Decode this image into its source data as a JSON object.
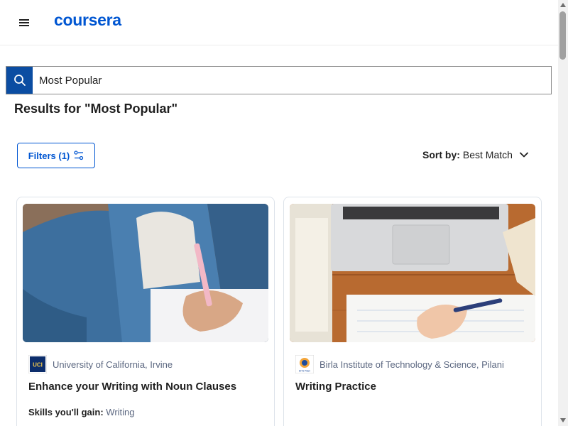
{
  "header": {
    "logo_text": "coursera",
    "menu_icon": "hamburger-icon"
  },
  "search": {
    "value": "Most Popular",
    "icon": "search-icon"
  },
  "results": {
    "title": "Results for \"Most Popular\""
  },
  "toolbar": {
    "filters_label": "Filters (1)",
    "filters_icon": "filter-settings-icon",
    "sort_label": "Sort by:",
    "sort_value": "Best Match",
    "sort_icon": "chevron-down-icon"
  },
  "cards": [
    {
      "partner_name": "University of California, Irvine",
      "partner_logo_text": "UCI",
      "title": "Enhance your Writing with Noun Clauses",
      "skills_label": "Skills you'll gain:",
      "skills_value": "Writing"
    },
    {
      "partner_name": "Birla Institute of Technology & Science, Pilani",
      "partner_logo_text": "BITS Pilani",
      "title": "Writing Practice"
    }
  ],
  "colors": {
    "brand": "#0056d2",
    "search_button": "#0b4da2",
    "muted_text": "#5b6780"
  }
}
